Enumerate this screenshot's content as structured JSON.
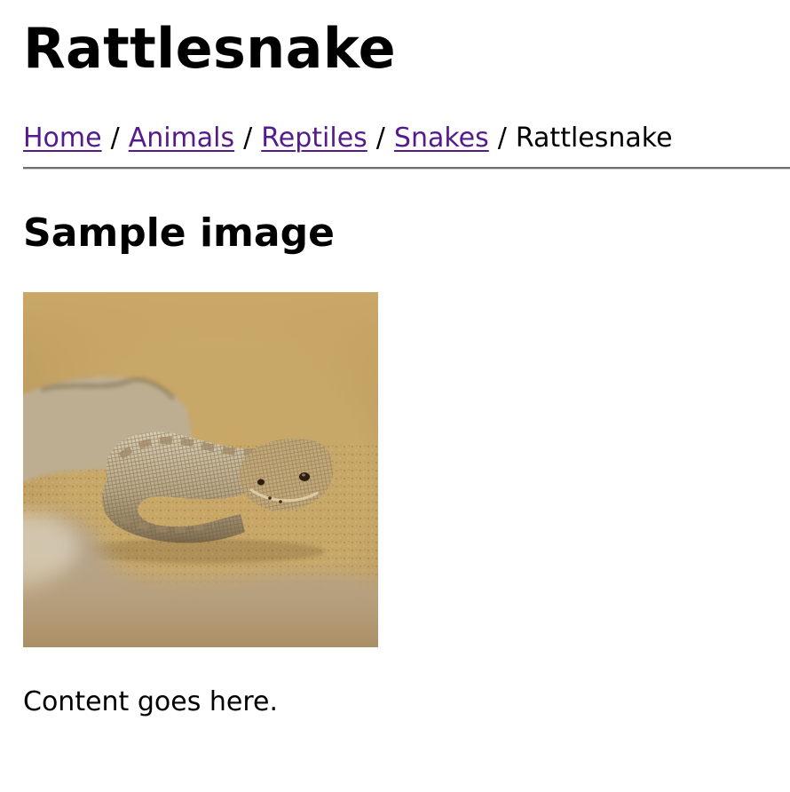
{
  "page": {
    "title": "Rattlesnake"
  },
  "breadcrumb": {
    "items": [
      {
        "label": "Home",
        "link": true
      },
      {
        "label": "Animals",
        "link": true
      },
      {
        "label": "Reptiles",
        "link": true
      },
      {
        "label": "Snakes",
        "link": true
      },
      {
        "label": "Rattlesnake",
        "link": false
      }
    ],
    "separator": "/"
  },
  "section": {
    "heading": "Sample image"
  },
  "image": {
    "subject": "rattlesnake"
  },
  "content": {
    "text": "Content goes here."
  },
  "colors": {
    "visited_link": "#551a8b",
    "text": "#000000",
    "rule": "#6f6f6f"
  }
}
